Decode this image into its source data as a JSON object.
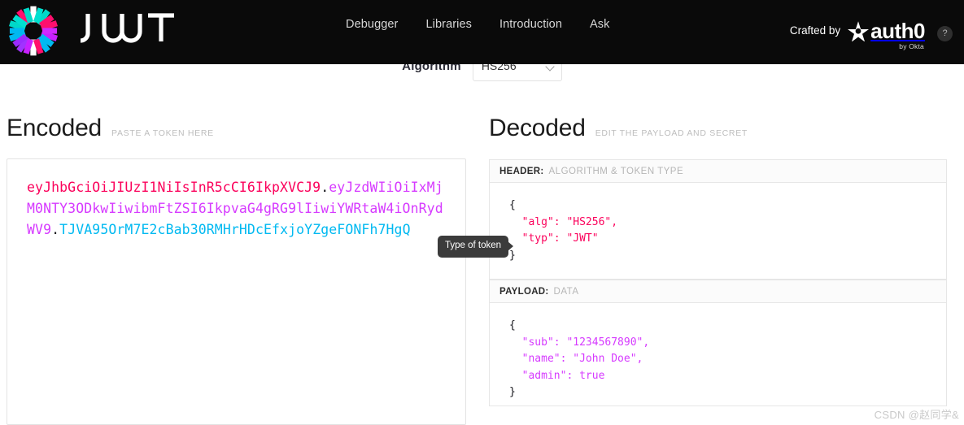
{
  "header": {
    "brand_name": "JWT",
    "logo_icon": "jwt-starburst-logo",
    "nav": [
      {
        "label": "Debugger"
      },
      {
        "label": "Libraries"
      },
      {
        "label": "Introduction"
      },
      {
        "label": "Ask"
      }
    ],
    "crafted_by_label": "Crafted by",
    "auth0_word": "auth0",
    "auth0_sub": "by Okta",
    "auth0_icon": "auth0-star-icon",
    "help_icon": "question-mark-icon",
    "help_label": "?",
    "bg_color": "#0a0a0a"
  },
  "algorithm": {
    "label": "Algorithm",
    "selected": "HS256",
    "caret_icon": "chevron-down-icon"
  },
  "encoded": {
    "title": "Encoded",
    "subtitle": "PASTE A TOKEN HERE",
    "token": {
      "header_part": "eyJhbGciOiJIUzI1NiIsInR5cCI6IkpXVCJ9",
      "payload_part": "eyJzdWIiOiIxMjM0NTY3ODkwIiwibmFtZSI6IkpvaG4gRG9lIiwiYWRtaW4iOnRydWV9",
      "signature_part": "TJVA95OrM7E2cBab30RMHrHDcEfxjoYZgeFONFh7HgQ",
      "separator": ".",
      "header_color": "#fb015b",
      "payload_color": "#d63aff",
      "signature_color": "#00b9f1"
    }
  },
  "tooltip": {
    "text": "Type of token"
  },
  "decoded": {
    "title": "Decoded",
    "subtitle": "EDIT THE PAYLOAD AND SECRET",
    "sections": [
      {
        "band_strong": "HEADER:",
        "band_muted": "ALGORITHM & TOKEN TYPE",
        "open_brace": "{",
        "close_brace": "}",
        "lines": "  \"alg\": \"HS256\",\n  \"typ\": \"JWT\"",
        "color": "#fb015b"
      },
      {
        "band_strong": "PAYLOAD:",
        "band_muted": "DATA",
        "open_brace": "{",
        "close_brace": "}",
        "lines": "  \"sub\": \"1234567890\",\n  \"name\": \"John Doe\",\n  \"admin\": true",
        "color": "#d63aff"
      }
    ]
  },
  "watermark": {
    "text": "CSDN @赵同学&"
  }
}
